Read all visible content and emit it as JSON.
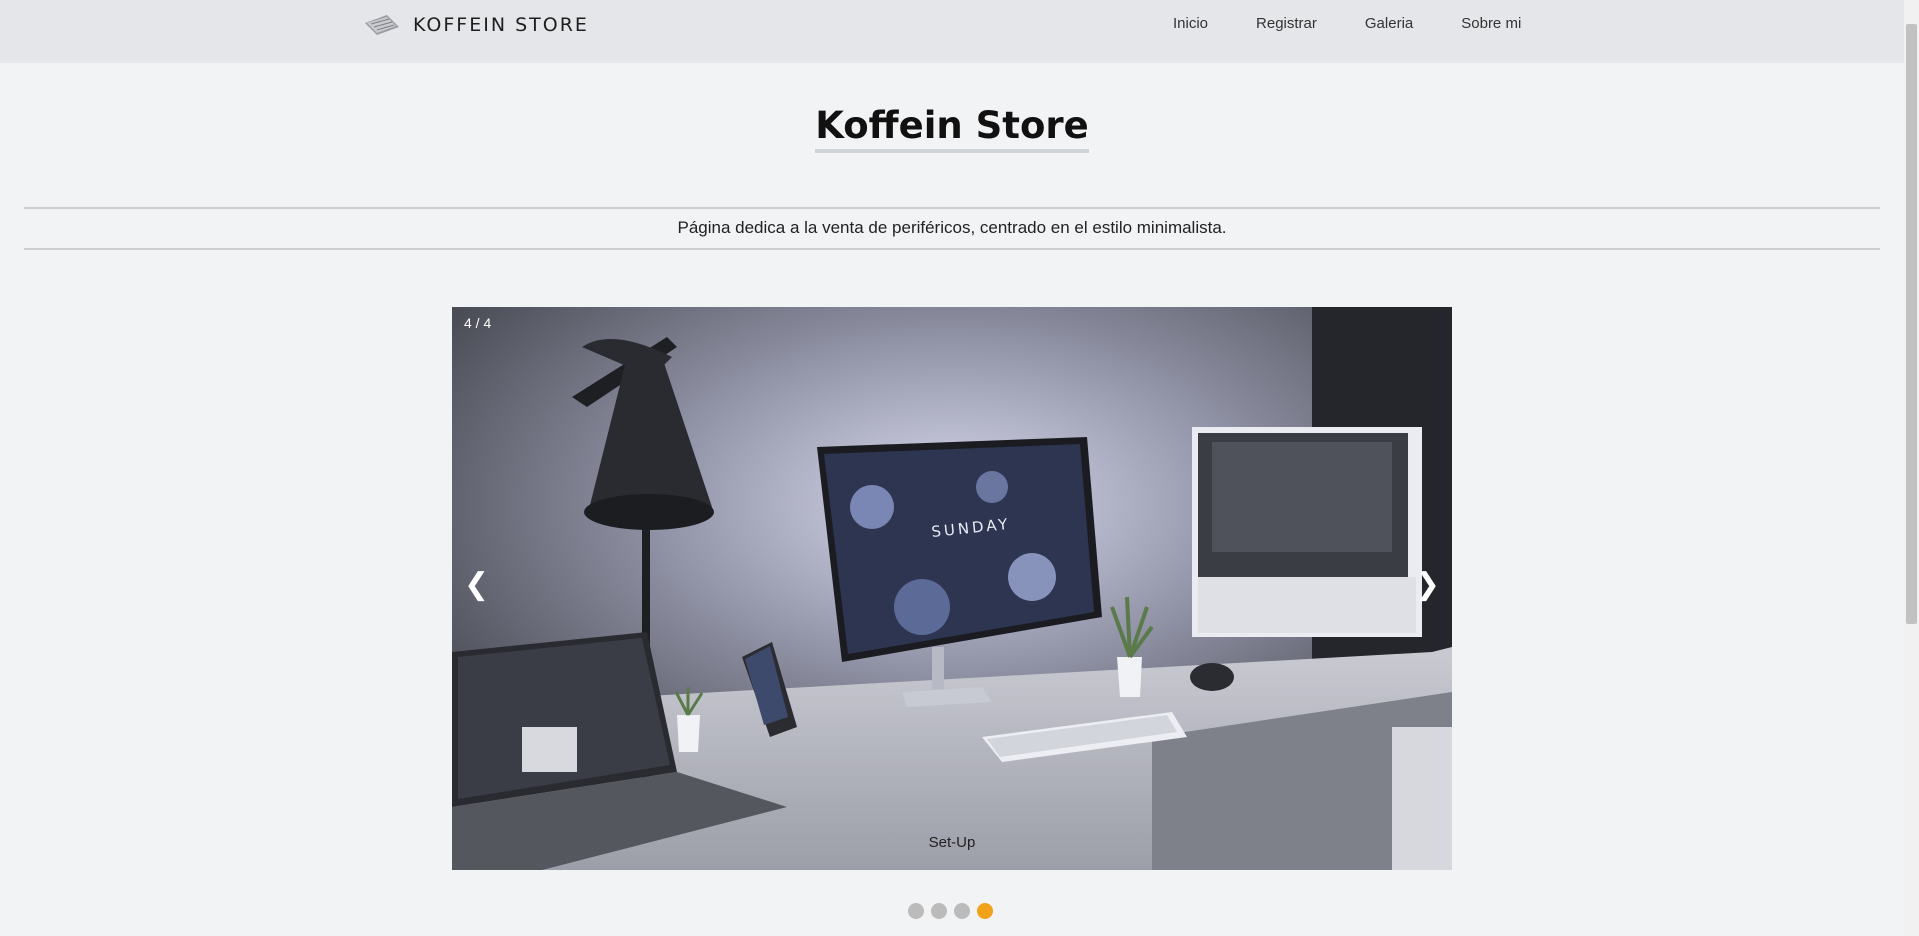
{
  "header": {
    "brand": "KOFFEIN STORE",
    "logo_icon": "keyboard-icon",
    "nav": [
      "Inicio",
      "Registrar",
      "Galeria",
      "Sobre mi"
    ]
  },
  "main": {
    "title": "Koffein Store",
    "subtitle": "Página dedica a la venta de periféricos, centrado en el estilo minimalista."
  },
  "slideshow": {
    "counter": "4 / 4",
    "prev_label": "❮",
    "next_label": "❯",
    "caption": "Set-Up",
    "current_slide": 4,
    "total_slides": 4,
    "screen_text": "SUNDAY",
    "active_dot_color": "#f0a21a"
  }
}
